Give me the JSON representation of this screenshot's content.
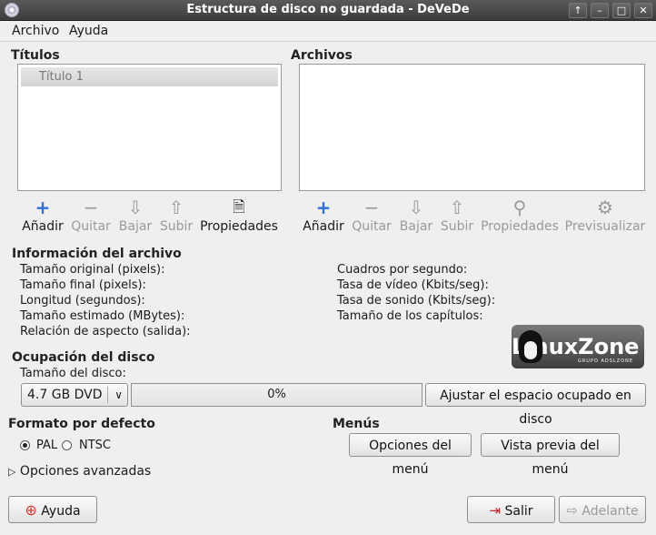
{
  "window": {
    "title": "Estructura de disco no guardada - DeVeDe"
  },
  "menubar": {
    "items": [
      "Archivo",
      "Ayuda"
    ]
  },
  "titles_panel": {
    "heading": "Títulos",
    "items": [
      "Título 1"
    ],
    "toolbar": {
      "add": "Añadir",
      "remove": "Quitar",
      "down": "Bajar",
      "up": "Subir",
      "properties": "Propiedades"
    }
  },
  "files_panel": {
    "heading": "Archivos",
    "items": [],
    "toolbar": {
      "add": "Añadir",
      "remove": "Quitar",
      "down": "Bajar",
      "up": "Subir",
      "properties": "Propiedades",
      "preview": "Previsualizar"
    }
  },
  "file_info": {
    "heading": "Información del archivo",
    "left": [
      "Tamaño original (pixels):",
      "Tamaño final (pixels):",
      "Longitud (segundos):",
      "Tamaño estimado (MBytes):",
      "Relación de aspecto (salida):"
    ],
    "right": [
      "Cuadros por segundo:",
      "Tasa de vídeo (Kbits/seg):",
      "Tasa de sonido (Kbits/seg):",
      "Tamaño de los capítulos:"
    ]
  },
  "logo": {
    "text": "LinuxZone",
    "sub": "GRUPO ADSLZONE"
  },
  "disk": {
    "heading": "Ocupación del disco",
    "size_label": "Tamaño del disco:",
    "size_value": "4.7 GB DVD",
    "usage_percent": 0,
    "usage_text": "0%",
    "adjust_button": "Ajustar el espacio ocupado en disco"
  },
  "format": {
    "heading": "Formato por defecto",
    "options": [
      "PAL",
      "NTSC"
    ],
    "selected": "PAL"
  },
  "menus": {
    "heading": "Menús",
    "options_button": "Opciones del menú",
    "preview_button": "Vista previa del menú"
  },
  "advanced": {
    "label": "Opciones avanzadas"
  },
  "bottom": {
    "help": "Ayuda",
    "quit": "Salir",
    "forward": "Adelante"
  },
  "colors": {
    "accent": "#2f6fd6",
    "disabled": "#9a9a9a"
  }
}
